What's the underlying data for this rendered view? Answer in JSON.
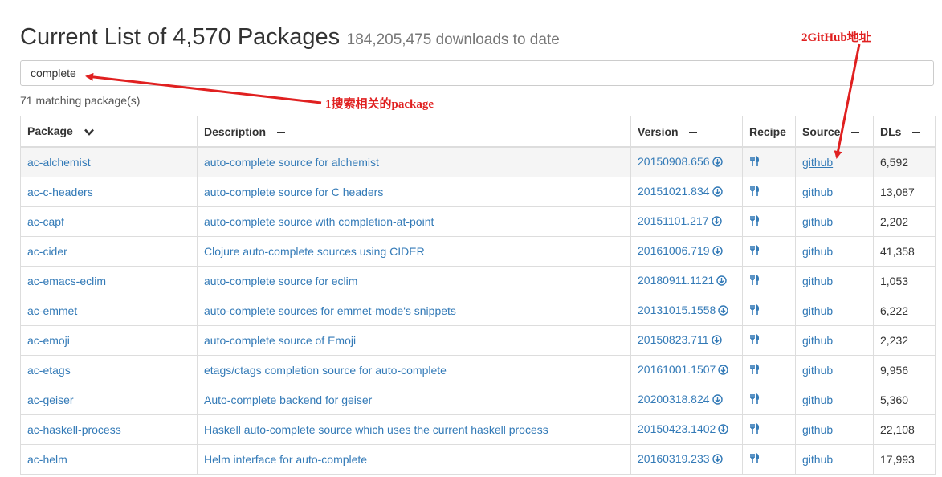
{
  "page": {
    "title": "Current List of 4,570 Packages",
    "subtitle": "184,205,475 downloads to date"
  },
  "search": {
    "value": "complete"
  },
  "match_count": "71 matching package(s)",
  "table": {
    "headers": {
      "package": "Package",
      "description": "Description",
      "version": "Version",
      "recipe": "Recipe",
      "source": "Source",
      "dls": "DLs"
    },
    "rows": [
      {
        "package": "ac-alchemist",
        "description": "auto-complete source for alchemist",
        "version": "20150908.656",
        "source": "github",
        "dls": "6,592"
      },
      {
        "package": "ac-c-headers",
        "description": "auto-complete source for C headers",
        "version": "20151021.834",
        "source": "github",
        "dls": "13,087"
      },
      {
        "package": "ac-capf",
        "description": "auto-complete source with completion-at-point",
        "version": "20151101.217",
        "source": "github",
        "dls": "2,202"
      },
      {
        "package": "ac-cider",
        "description": "Clojure auto-complete sources using CIDER",
        "version": "20161006.719",
        "source": "github",
        "dls": "41,358"
      },
      {
        "package": "ac-emacs-eclim",
        "description": "auto-complete source for eclim",
        "version": "20180911.1121",
        "source": "github",
        "dls": "1,053"
      },
      {
        "package": "ac-emmet",
        "description": "auto-complete sources for emmet-mode's snippets",
        "version": "20131015.1558",
        "source": "github",
        "dls": "6,222"
      },
      {
        "package": "ac-emoji",
        "description": "auto-complete source of Emoji",
        "version": "20150823.711",
        "source": "github",
        "dls": "2,232"
      },
      {
        "package": "ac-etags",
        "description": "etags/ctags completion source for auto-complete",
        "version": "20161001.1507",
        "source": "github",
        "dls": "9,956"
      },
      {
        "package": "ac-geiser",
        "description": "Auto-complete backend for geiser",
        "version": "20200318.824",
        "source": "github",
        "dls": "5,360"
      },
      {
        "package": "ac-haskell-process",
        "description": "Haskell auto-complete source which uses the current haskell process",
        "version": "20150423.1402",
        "source": "github",
        "dls": "22,108"
      },
      {
        "package": "ac-helm",
        "description": "Helm interface for auto-complete",
        "version": "20160319.233",
        "source": "github",
        "dls": "17,993"
      }
    ]
  },
  "annotations": {
    "search_note": "1搜索相关的package",
    "github_note": "2GitHub地址"
  },
  "colors": {
    "link": "#337ab7",
    "annotation": "#e02020",
    "border": "#dddddd"
  }
}
